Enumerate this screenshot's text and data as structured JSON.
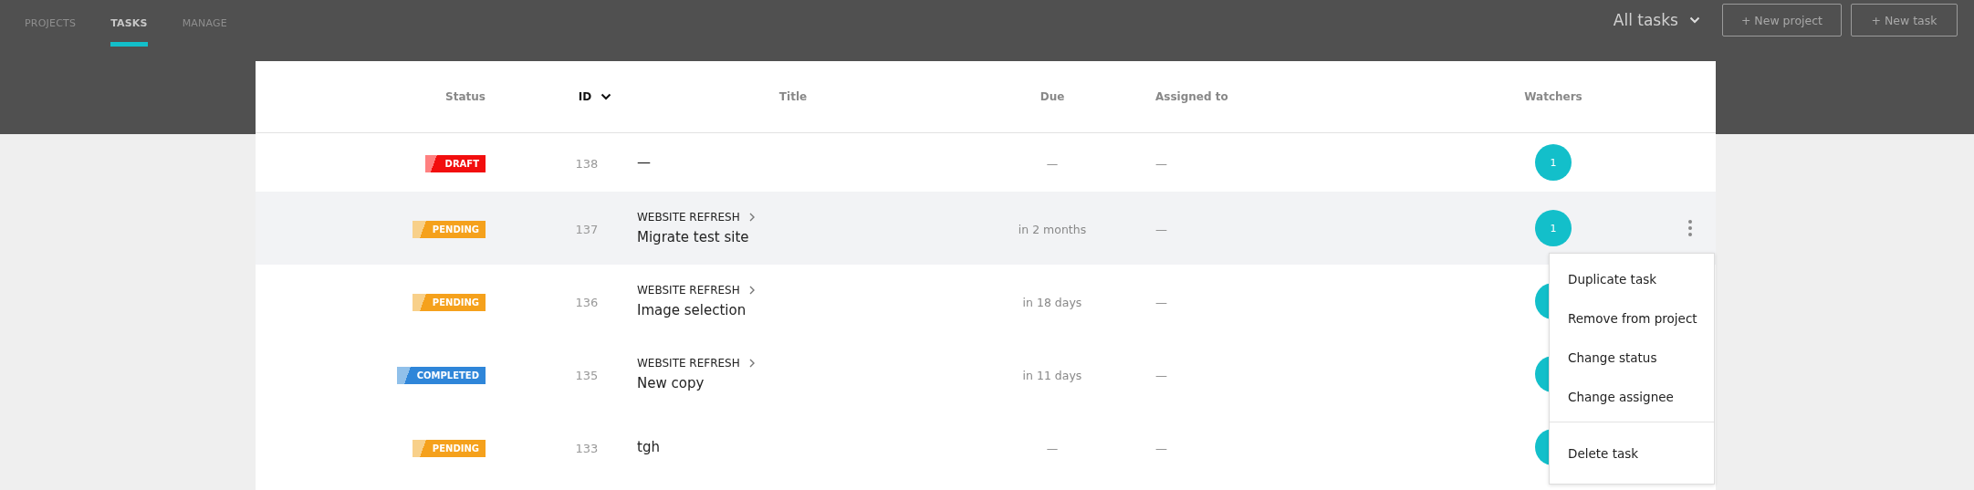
{
  "nav": {
    "tabs": [
      {
        "label": "PROJECTS",
        "selected": false
      },
      {
        "label": "TASKS",
        "selected": true
      },
      {
        "label": "MANAGE",
        "selected": false
      }
    ],
    "filter": {
      "label": "All tasks"
    },
    "buttons": [
      "+ New project",
      "+ New task"
    ]
  },
  "table": {
    "columns": [
      {
        "label": "Status",
        "sorted": false
      },
      {
        "label": "ID",
        "sorted": true
      },
      {
        "label": "Title",
        "sorted": false
      },
      {
        "label": "Due",
        "sorted": false
      },
      {
        "label": "Assigned to",
        "sorted": false
      },
      {
        "label": "Watchers",
        "sorted": false
      }
    ],
    "rows": [
      {
        "status": "DRAFT",
        "kind": "draft",
        "id": "138",
        "project": "",
        "title": "—",
        "due": "—",
        "assigned": "—",
        "watchers": "1",
        "selected": false
      },
      {
        "status": "PENDING",
        "kind": "pending",
        "id": "137",
        "project": "WEBSITE REFRESH",
        "title": "Migrate test site",
        "due": "in 2 months",
        "assigned": "—",
        "watchers": "1",
        "selected": true
      },
      {
        "status": "PENDING",
        "kind": "pending",
        "id": "136",
        "project": "WEBSITE REFRESH",
        "title": "Image selection",
        "due": "in 18 days",
        "assigned": "—",
        "watchers": "",
        "selected": false
      },
      {
        "status": "COMPLETED",
        "kind": "completed",
        "id": "135",
        "project": "WEBSITE REFRESH",
        "title": "New copy",
        "due": "in 11 days",
        "assigned": "—",
        "watchers": "",
        "selected": false
      },
      {
        "status": "PENDING",
        "kind": "pending",
        "id": "133",
        "project": "",
        "title": "tgh",
        "due": "—",
        "assigned": "—",
        "watchers": "",
        "selected": false
      }
    ]
  },
  "menu": {
    "items": [
      "Duplicate task",
      "Remove from project",
      "Change status",
      "Change assignee"
    ],
    "danger_items": [
      "Delete task"
    ]
  }
}
